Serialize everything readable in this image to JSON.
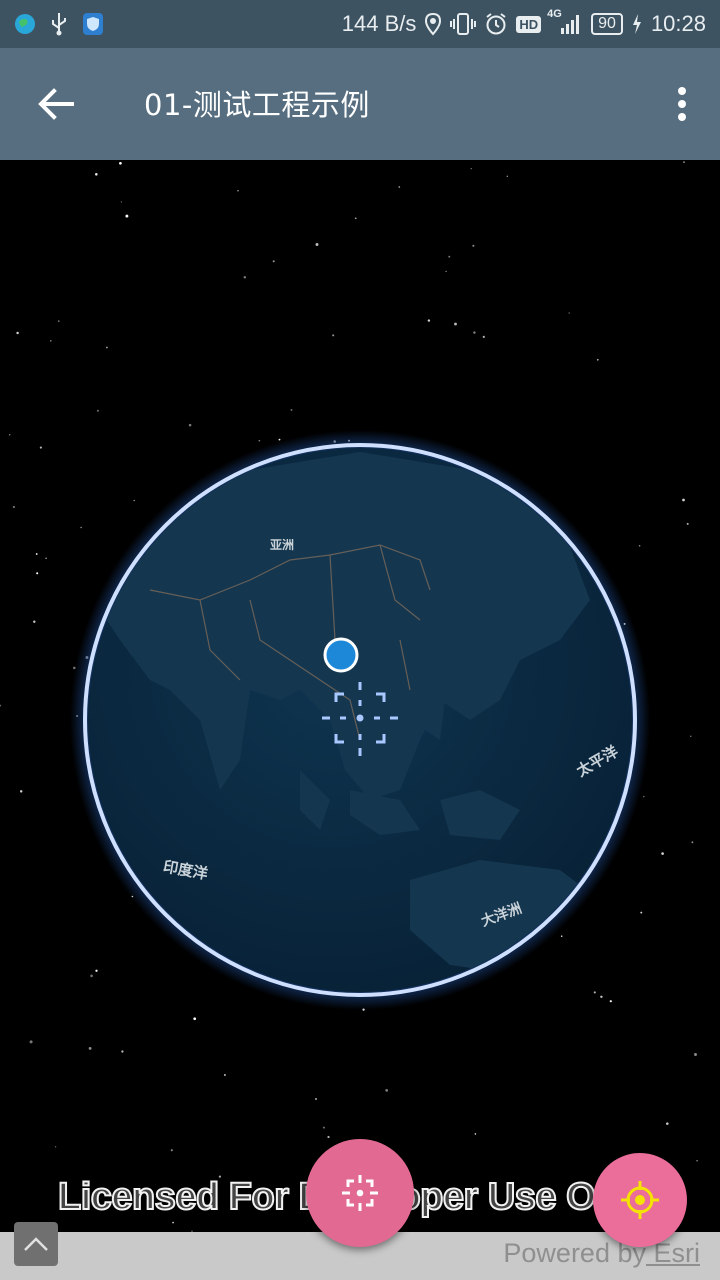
{
  "status_bar": {
    "net_speed": "144 B/s",
    "network_type": "4G",
    "hd_badge": "HD",
    "battery": "90",
    "time": "10:28",
    "icons": [
      "app-globe-icon",
      "usb-icon",
      "shield-icon",
      "location-icon",
      "vibrate-icon",
      "alarm-icon",
      "signal-icon",
      "charging-icon"
    ]
  },
  "app_bar": {
    "title": "01-测试工程示例",
    "back_icon": "arrow-back-icon",
    "menu_icon": "more-vert-icon"
  },
  "map": {
    "labels": {
      "asia": "亚洲",
      "pacific": "太平洋",
      "indian_ocean": "印度洋",
      "oceania": "大洋洲"
    },
    "location_marker_color": "#1e88d8",
    "globe_color": "#0c2a42"
  },
  "overlay": {
    "license_text": "Licensed For Developer Use Only",
    "powered_by_prefix": "Powered by",
    "powered_by_link": " Esri"
  },
  "controls": {
    "expand_icon": "chevron-up-icon",
    "center_fab_icon": "crosshair-icon",
    "locate_fab_icon": "my-location-icon",
    "fab_color": "#e26a92",
    "locate_icon_color": "#f5e400"
  }
}
